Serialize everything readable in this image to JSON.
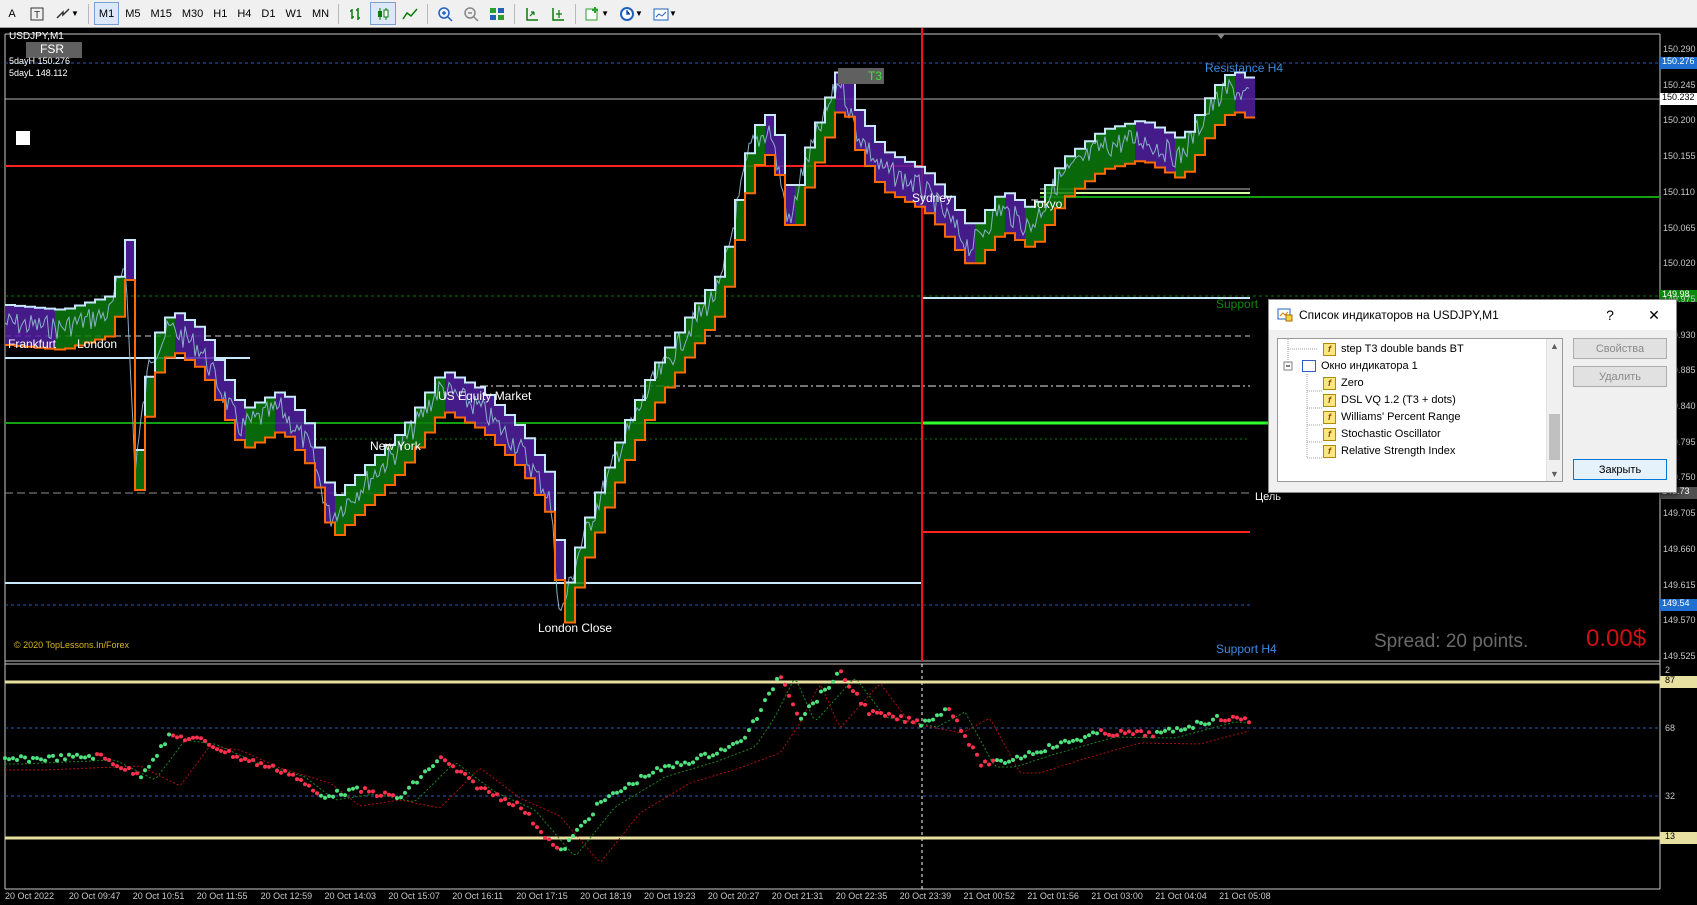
{
  "toolbar": {
    "timeframes": [
      "M1",
      "M5",
      "M15",
      "M30",
      "H1",
      "H4",
      "D1",
      "W1",
      "MN"
    ],
    "selected_timeframe": "M1"
  },
  "chart": {
    "symbol": "USDJPY,M1",
    "fsr_label": "FSR",
    "day_high": "5dayH 150.276",
    "day_low": "5dayL 148.112",
    "t3_label": "T3",
    "copyright": "© 2020 TopLessons.In/Forex",
    "spread": "Spread: 20 points.",
    "profit": "0.00$",
    "target_label": "Цель",
    "resistance_label": "Resistance H4",
    "support_label": "Support H4",
    "support_cut_label": "Support",
    "sessions": [
      {
        "name": "Frankfurt"
      },
      {
        "name": "London"
      },
      {
        "name": "US Equity Market"
      },
      {
        "name": "New York"
      },
      {
        "name": "London Close"
      },
      {
        "name": "Sydney"
      },
      {
        "name": "Tokyo"
      }
    ],
    "price_axis": [
      "150.290",
      "150.245",
      "150.200",
      "150.155",
      "150.110",
      "150.065",
      "150.020",
      "149.975",
      "149.930",
      "149.885",
      "149.840",
      "149.795",
      "149.750",
      "149.705",
      "149.660",
      "149.615",
      "149.570",
      "149.525"
    ],
    "price_tags": [
      {
        "value": "150.276",
        "color": "#1e6fd0"
      },
      {
        "value": "150.232",
        "color": "#ffffff"
      },
      {
        "value": "149.98",
        "color": "#0a8a0a"
      },
      {
        "value": "149.73",
        "color": "#505050"
      },
      {
        "value": "149.54",
        "color": "#1e6fd0"
      }
    ],
    "osc_axis": [
      "2",
      "87",
      "68",
      "32",
      "13"
    ],
    "time_axis": [
      "20 Oct 2022",
      "20 Oct 09:47",
      "20 Oct 10:51",
      "20 Oct 11:55",
      "20 Oct 12:59",
      "20 Oct 14:03",
      "20 Oct 15:07",
      "20 Oct 16:11",
      "20 Oct 17:15",
      "20 Oct 18:19",
      "20 Oct 19:23",
      "20 Oct 20:27",
      "20 Oct 21:31",
      "20 Oct 22:35",
      "20 Oct 23:39",
      "21 Oct 00:52",
      "21 Oct 01:56",
      "21 Oct 03:00",
      "21 Oct 04:04",
      "21 Oct 05:08"
    ]
  },
  "dialog": {
    "title": "Список индикаторов на USDJPY,M1",
    "help": "?",
    "close": "✕",
    "items": [
      {
        "label": "step T3 double bands BT",
        "type": "indicator"
      },
      {
        "label": "Окно индикатора 1",
        "type": "window"
      },
      {
        "label": "Zero",
        "type": "indicator"
      },
      {
        "label": "DSL VQ 1.2 (T3 + dots)",
        "type": "indicator"
      },
      {
        "label": "Williams' Percent Range",
        "type": "indicator"
      },
      {
        "label": "Stochastic Oscillator",
        "type": "indicator"
      },
      {
        "label": "Relative Strength Index",
        "type": "indicator"
      }
    ],
    "buttons": {
      "properties": "Свойства",
      "delete": "Удалить",
      "close": "Закрыть"
    }
  }
}
